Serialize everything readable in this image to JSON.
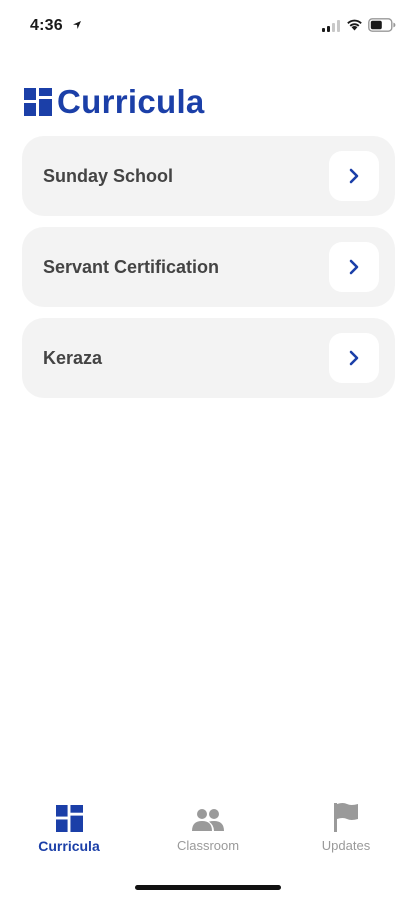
{
  "status_bar": {
    "time": "4:36",
    "icons": [
      "location-arrow-icon",
      "signal-icon",
      "wifi-icon",
      "battery-icon"
    ]
  },
  "header": {
    "title": "Curricula",
    "logo_icon": "grid-logo-icon"
  },
  "curricula": [
    {
      "label": "Sunday School"
    },
    {
      "label": "Servant Certification"
    },
    {
      "label": "Keraza"
    }
  ],
  "tab_bar": {
    "tabs": [
      {
        "label": "Curricula",
        "icon": "grid-logo-icon",
        "active": true
      },
      {
        "label": "Classroom",
        "icon": "people-icon",
        "active": false
      },
      {
        "label": "Updates",
        "icon": "flag-icon",
        "active": false
      }
    ]
  },
  "colors": {
    "accent": "#1b3fa8",
    "card_bg": "#f3f3f3",
    "inactive": "#9a9a9a"
  }
}
